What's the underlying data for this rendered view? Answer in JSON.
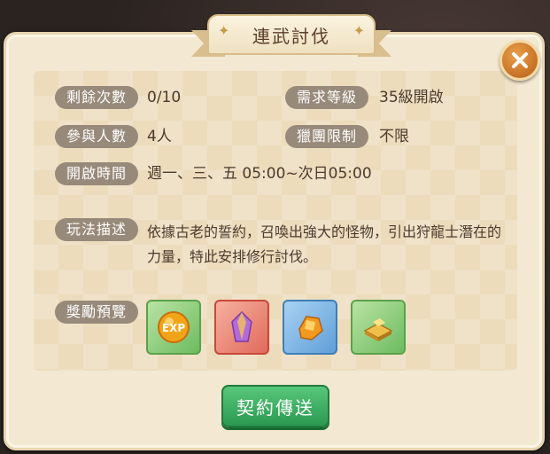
{
  "title": "連武討伐",
  "info": {
    "remaining_label": "剩餘次數",
    "remaining_value": "0/10",
    "required_level_label": "需求等級",
    "required_level_value": "35級開啟",
    "participants_label": "參與人數",
    "participants_value": "4人",
    "guild_label": "獵團限制",
    "guild_value": "不限",
    "open_time_label": "開啟時間",
    "open_time_value": "週一、三、五 05:00~次日05:00",
    "gameplay_label": "玩法描述",
    "gameplay_value": "依據古老的誓約，召喚出強大的怪物，引出狩龍士潛在的力量，特此安排修行討伐。",
    "rewards_label": "獎勵預覽"
  },
  "rewards": [
    {
      "icon": "exp-orb-icon",
      "text": "EXP",
      "color": "green"
    },
    {
      "icon": "purple-crystal-icon",
      "color": "red"
    },
    {
      "icon": "orange-crystal-icon",
      "color": "blue"
    },
    {
      "icon": "gold-ingot-icon",
      "color": "green"
    }
  ],
  "button": {
    "label": "契約傳送"
  }
}
